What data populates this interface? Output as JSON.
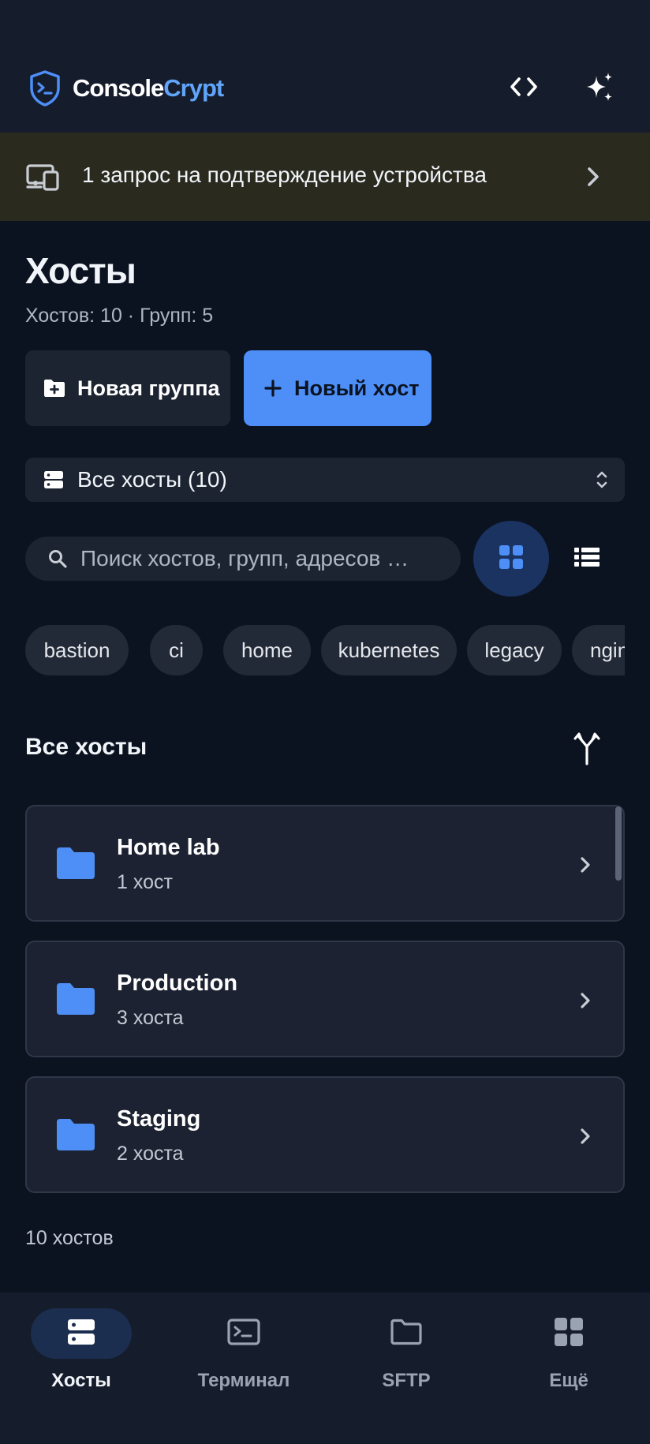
{
  "app": {
    "brand_part1": "Console",
    "brand_part2": "Crypt",
    "colors": {
      "accent": "#4d8ff7",
      "brand_accent": "#60a5fa",
      "background": "#0b1220",
      "surface": "#1c2231",
      "banner": "#2a2a1f"
    }
  },
  "topbar": {
    "icons": [
      "code-icon",
      "sparkles-icon"
    ]
  },
  "banner": {
    "text": "1 запрос на подтверждение устройства",
    "icon": "devices-icon"
  },
  "page": {
    "title": "Хосты",
    "subtitle": "Хостов: 10 · Групп: 5"
  },
  "actions": {
    "new_group": "Новая группа",
    "new_host": "Новый хост"
  },
  "filter": {
    "selected": "Все хосты (10)"
  },
  "search": {
    "placeholder": "Поиск хостов, групп, адресов …"
  },
  "view": {
    "mode": "grid"
  },
  "tags": [
    "bastion",
    "ci",
    "home",
    "kubernetes",
    "legacy",
    "nginx"
  ],
  "section": {
    "title": "Все хосты"
  },
  "groups": [
    {
      "name": "Home lab",
      "count": "1 хост"
    },
    {
      "name": "Production",
      "count": "3 хоста"
    },
    {
      "name": "Staging",
      "count": "2 хоста"
    }
  ],
  "footer": {
    "count": "10 хостов"
  },
  "nav": [
    {
      "label": "Хосты",
      "icon": "server-icon",
      "active": true
    },
    {
      "label": "Терминал",
      "icon": "terminal-icon",
      "active": false
    },
    {
      "label": "SFTP",
      "icon": "folder-icon",
      "active": false
    },
    {
      "label": "Ещё",
      "icon": "grid-icon",
      "active": false
    }
  ]
}
